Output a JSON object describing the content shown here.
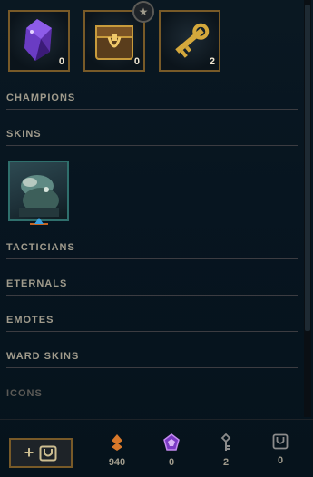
{
  "top_slots": [
    {
      "icon": "gemstone-icon",
      "count": "0"
    },
    {
      "icon": "hextech-chest-icon",
      "count": "0"
    },
    {
      "icon": "key-fragment-icon",
      "count": "2"
    }
  ],
  "badge": {
    "icon": "star-icon"
  },
  "sections": {
    "champions": "CHAMPIONS",
    "skins": "SKINS",
    "tacticians": "TACTICIANS",
    "eternals": "ETERNALS",
    "emotes": "EMOTES",
    "ward_skins": "WARD SKINS",
    "icons": "ICONS"
  },
  "skin_tile": {
    "icon": "skin-portrait-icon"
  },
  "craft_button": {
    "plus": "+",
    "icon": "chest-outline-icon"
  },
  "currencies": [
    {
      "icon": "orange-essence-icon",
      "value": "940",
      "color": "#d8782a"
    },
    {
      "icon": "mythic-essence-icon",
      "value": "0",
      "color": "#b26ae0"
    },
    {
      "icon": "key-icon",
      "value": "2",
      "color": "#8c8c8c"
    },
    {
      "icon": "chest-icon",
      "value": "0",
      "color": "#8c8c8c"
    }
  ]
}
